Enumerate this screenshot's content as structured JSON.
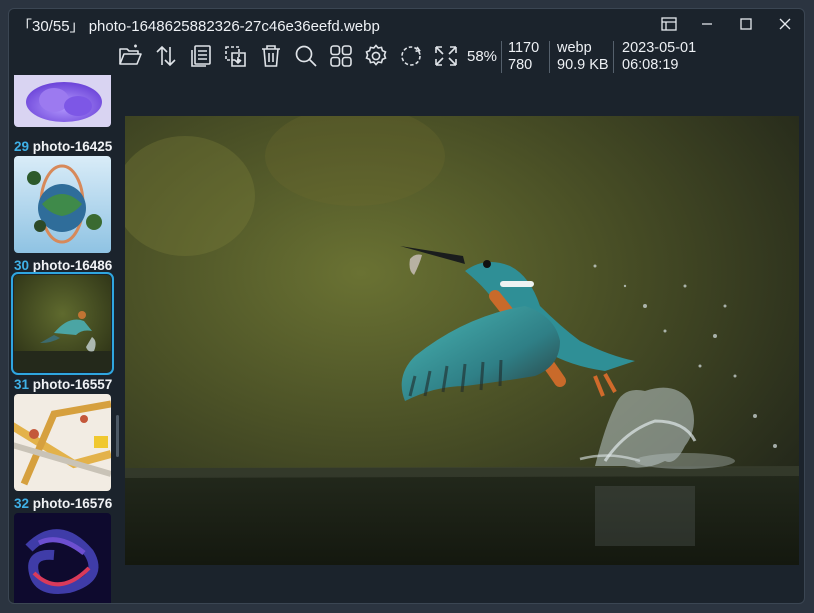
{
  "window": {
    "title": "「30/55」 photo-1648625882326-27c46e36eefd.webp"
  },
  "toolbar": {
    "buttons": [
      {
        "name": "open-folder-icon"
      },
      {
        "name": "sort-icon"
      },
      {
        "name": "copy-icon"
      },
      {
        "name": "move-icon"
      },
      {
        "name": "delete-icon"
      },
      {
        "name": "zoom-icon"
      },
      {
        "name": "gallery-icon"
      },
      {
        "name": "settings-icon"
      },
      {
        "name": "rotate-icon"
      },
      {
        "name": "fit-screen-icon"
      }
    ],
    "zoom_level": "58%"
  },
  "info": {
    "width": "1170",
    "height": "780",
    "format": "webp",
    "size": "90.9 KB",
    "date": "2023-05-01",
    "time": "06:08:19"
  },
  "thumbnails": [
    {
      "number": "29",
      "name": "photo-16425"
    },
    {
      "number": "30",
      "name": "photo-16486"
    },
    {
      "number": "31",
      "name": "photo-16557"
    },
    {
      "number": "32",
      "name": "photo-16576"
    }
  ],
  "colors": {
    "accent": "#2fa6e0",
    "window_bg": "#1b232c"
  }
}
